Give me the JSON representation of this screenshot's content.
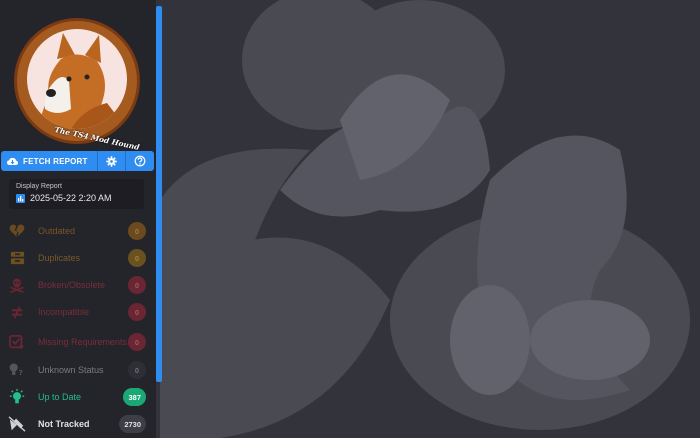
{
  "logo": {
    "text": "The TS4 Mod Hound"
  },
  "toolbar": {
    "fetch_label": "FETCH REPORT"
  },
  "display_report": {
    "label": "Display Report",
    "value": "2025-05-22 2:20 AM"
  },
  "items": [
    {
      "label": "Outdated",
      "count": "0",
      "icon": "broken-heart-icon"
    },
    {
      "label": "Duplicates",
      "count": "0",
      "icon": "duplicate-box-icon"
    },
    {
      "label": "Broken/Obsolete",
      "count": "0",
      "icon": "skull-crossbones-icon"
    },
    {
      "label": "Incompatible",
      "count": "0",
      "icon": "not-equal-icon"
    },
    {
      "label": "Missing Requirements",
      "count": "0",
      "icon": "missing-check-icon"
    },
    {
      "label": "Unknown Status",
      "count": "0",
      "icon": "lightbulb-question-icon"
    },
    {
      "label": "Up to Date",
      "count": "387",
      "icon": "lightbulb-on-icon"
    },
    {
      "label": "Not Tracked",
      "count": "2730",
      "icon": "untracked-tool-icon"
    }
  ],
  "colors": {
    "accent": "#2f8cf0",
    "outdated": "#8a5a1e",
    "duplicates": "#8a6a1e",
    "broken": "#8a2e3e",
    "up_to_date": "#22c08a",
    "neutral": "#4a4a52"
  }
}
